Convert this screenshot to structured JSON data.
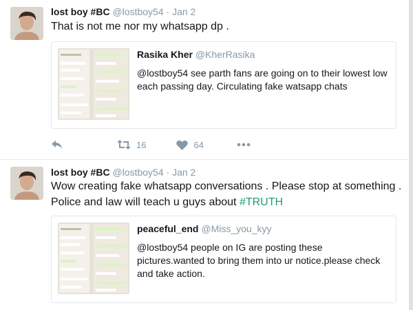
{
  "tweets": [
    {
      "author_name": "lost boy #BC",
      "author_handle": "@lostboy54",
      "separator": "·",
      "time": "Jan 2",
      "text": "That is not me nor my whatsapp dp .",
      "quote": {
        "name": "Rasika Kher",
        "handle": "@KherRasika",
        "text": "@lostboy54 see parth fans are going on to their lowest low each passing day. Circulating fake watsapp chats"
      },
      "actions": {
        "reply_icon": "reply-icon",
        "retweet_icon": "retweet-icon",
        "retweet_count": "16",
        "like_icon": "heart-icon",
        "like_count": "64",
        "more_icon": "more-icon"
      }
    },
    {
      "author_name": "lost boy #BC",
      "author_handle": "@lostboy54",
      "separator": "·",
      "time": "Jan 2",
      "text_main": "Wow creating fake whatsapp conversations . Please stop at something . Police and law will teach u guys about ",
      "hashtag": "#TRUTH",
      "quote": {
        "name": "peaceful_end",
        "handle": "@Miss_you_kyy",
        "text": "@lostboy54 people on IG are posting these pictures.wanted to bring them into ur notice.please check and take action."
      }
    }
  ],
  "colors": {
    "text": "#14171a",
    "muted": "#8899a6",
    "border": "#e1e8ed",
    "hashtag": "#1e9e6a"
  }
}
